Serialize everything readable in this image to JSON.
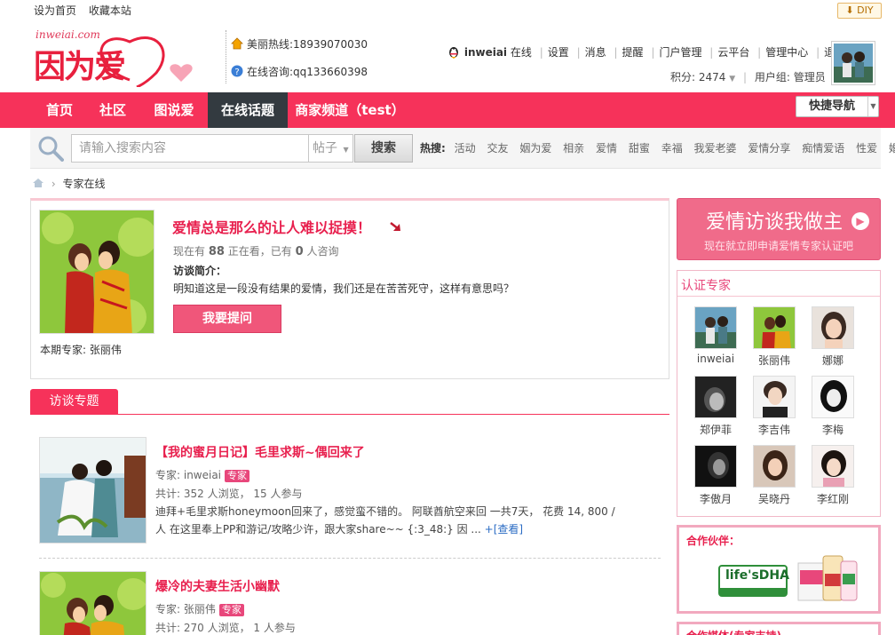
{
  "toplinks": {
    "home_label": "设为首页",
    "bookmark_label": "收藏本站"
  },
  "diy_label": "DIY",
  "logo": {
    "sub": "inweiai.com",
    "main": "因为爱"
  },
  "contact": {
    "hotline": "美丽热线:18939070030",
    "consult": "在线咨询:qq133660398"
  },
  "user": {
    "name": "inweiai",
    "status": "在线",
    "links": [
      "设置",
      "消息",
      "提醒",
      "门户管理",
      "云平台",
      "管理中心",
      "退出"
    ],
    "score_label": "积分: 2474",
    "group_label": "用户组: 管理员"
  },
  "nav": {
    "items": [
      "首页",
      "社区",
      "图说爱",
      "在线话题",
      "商家频道（test）"
    ],
    "active_index": 3,
    "quick_nav": "快捷导航"
  },
  "search": {
    "placeholder": "请输入搜索内容",
    "type": "帖子",
    "button": "搜索",
    "hot_label": "热搜:",
    "hot_words": [
      "活动",
      "交友",
      "姻为爱",
      "相亲",
      "爱情",
      "甜蜜",
      "幸福",
      "我爱老婆",
      "爱情分享",
      "痴情爱语",
      "性爱",
      "婚纱"
    ]
  },
  "breadcrumb": {
    "current": "专家在线"
  },
  "featured": {
    "title": "爱情总是那么的让人难以捉摸！",
    "stats_prefix": "现在有",
    "viewing_count": "88",
    "viewing_label": "正在看，已有",
    "consult_count": "0",
    "consult_label": "人咨询",
    "intro_heading": "访谈简介：",
    "intro_text": "明知道这是一段没有结果的爱情，我们还是在苦苦死守，这样有意思吗？",
    "ask_button": "我要提问",
    "expert_caption": "本期专家: 张丽伟"
  },
  "topics": {
    "tab_label": "访谈专题",
    "items": [
      {
        "title": "【我的蜜月日记】毛里求斯~偶回来了",
        "expert": "专家: inweiai",
        "tag": "专家",
        "stats": "共计: 352 人浏览，  15 人参与",
        "desc": "迪拜+毛里求斯honeymoon回来了，感觉蛮不错的。 阿联酋航空来回  一共7天，  花费  14, 800 / 人  在这里奉上PP和游记/攻略少许，跟大家share~~ {:3_48:} 因 ... ",
        "more": "+[查看]"
      },
      {
        "title": "爆冷的夫妻生活小幽默",
        "expert": "专家: 张丽伟",
        "tag": "专家",
        "stats": "共计: 270 人浏览，  1 人参与"
      }
    ]
  },
  "right": {
    "banner_title": "爱情访谈我做主",
    "banner_sub": "现在就立即申请爱情专家认证吧",
    "experts_heading": "认证专家",
    "experts": [
      "inweiai",
      "张丽伟",
      "娜娜",
      "郑伊菲",
      "李吉伟",
      "李梅",
      "李傲月",
      "吴晓丹",
      "李红刚"
    ],
    "partner_heading": "合作伙伴：",
    "media_heading": "合作媒体(专家支持)",
    "partner_logo": "life'sDHA"
  },
  "colors": {
    "brand": "#f6325a",
    "accent": "#e8204e",
    "nav_active": "#333a40"
  }
}
